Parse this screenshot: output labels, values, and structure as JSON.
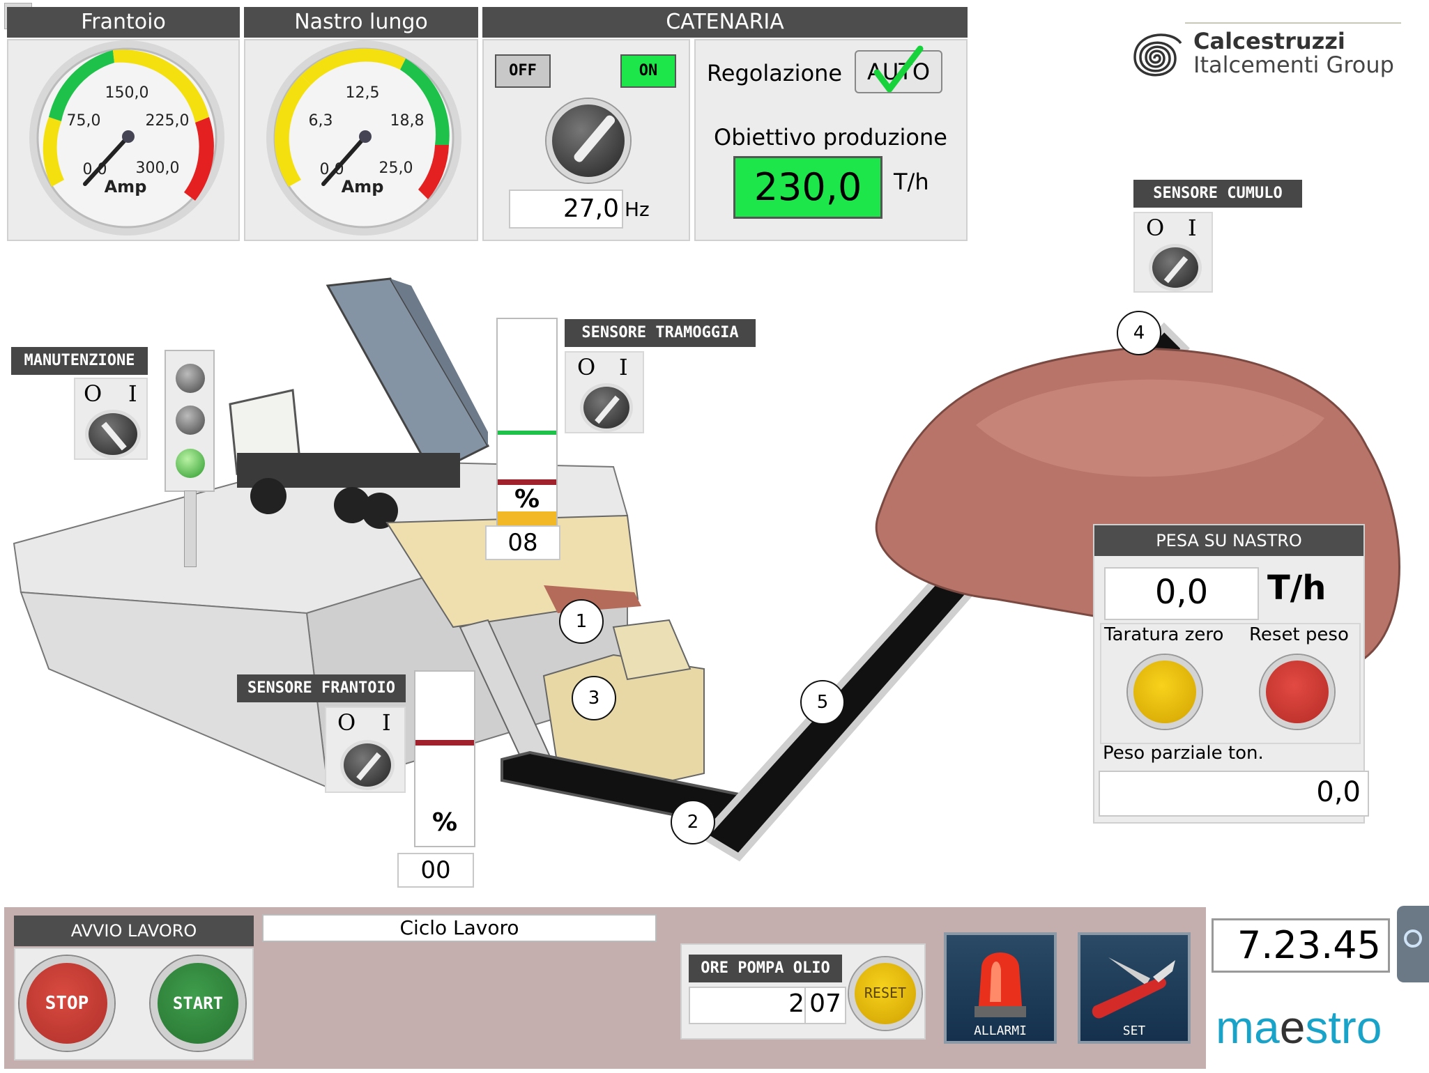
{
  "gauges": {
    "frantoio": {
      "title": "Frantoio",
      "ticks": [
        "0,0",
        "75,0",
        "150,0",
        "225,0",
        "300,0"
      ],
      "unit": "Amp"
    },
    "nastro": {
      "title": "Nastro lungo",
      "ticks": [
        "0,0",
        "6,3",
        "12,5",
        "18,8",
        "25,0"
      ],
      "unit": "Amp"
    }
  },
  "catenaria": {
    "title": "CATENARIA",
    "off_label": "OFF",
    "on_label": "ON",
    "frequency": "27,0",
    "frequency_unit": "Hz"
  },
  "regolazione": {
    "label": "Regolazione",
    "mode": "AUTO",
    "target_label": "Obiettivo produzione",
    "target_value": "230,0",
    "target_unit": "T/h"
  },
  "brand": {
    "line1": "Calcestruzzi",
    "line2": "Italcementi Group"
  },
  "sensors": {
    "cumulo": {
      "label": "SENSORE CUMULO",
      "o": "O",
      "i": "I"
    },
    "tramoggia": {
      "label": "SENSORE TRAMOGGIA",
      "o": "O",
      "i": "I"
    },
    "frantoio": {
      "label": "SENSORE FRANTOIO",
      "o": "O",
      "i": "I"
    },
    "manutenzione": {
      "label": "MANUTENZIONE",
      "o": "O",
      "i": "I"
    }
  },
  "level_hopper": {
    "unit": "%",
    "value": "08"
  },
  "level_crusher": {
    "unit": "%",
    "value": "00"
  },
  "markers": [
    "1",
    "2",
    "3",
    "4",
    "5"
  ],
  "pesa": {
    "title": "PESA SU NASTRO",
    "value": "0,0",
    "unit": "T/h",
    "taratura_label": "Taratura zero",
    "reset_label": "Reset peso",
    "parziale_label": "Peso parziale ton.",
    "parziale_value": "0,0"
  },
  "avvio": {
    "title": "AVVIO LAVORO",
    "stop": "STOP",
    "start": "START"
  },
  "ciclo": {
    "label": "Ciclo Lavoro"
  },
  "pompa": {
    "title": "ORE POMPA OLIO",
    "hours": "2",
    "minutes": "07",
    "reset": "RESET"
  },
  "buttons": {
    "allarmi": "ALLARMI",
    "set": "SET"
  },
  "clock": "7.23.45",
  "maestro": {
    "part1": "ma",
    "part2": "e",
    "part3": "stro"
  },
  "colors": {
    "accent_green": "#1de64a",
    "header_gray": "#4d4d4d",
    "bottom_bg": "#c4aeae",
    "stop_red": "#cc3a32",
    "start_green": "#2f8a3d"
  }
}
